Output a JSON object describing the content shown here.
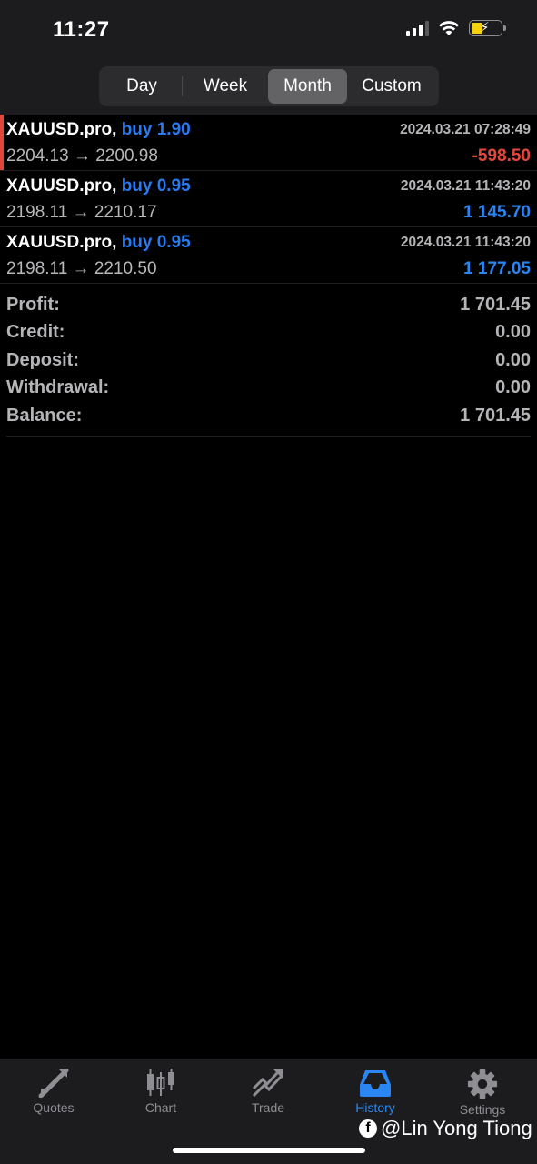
{
  "status_bar": {
    "time": "11:27"
  },
  "period_tabs": [
    {
      "label": "Day"
    },
    {
      "label": "Week"
    },
    {
      "label": "Month",
      "active": true
    },
    {
      "label": "Custom"
    }
  ],
  "trades": [
    {
      "symbol": "XAUUSD.pro,",
      "side": "buy 1.90",
      "datetime": "2024.03.21 07:28:49",
      "prices": "2204.13 → 2200.98",
      "profit": "-598.50",
      "result": "loss"
    },
    {
      "symbol": "XAUUSD.pro,",
      "side": "buy 0.95",
      "datetime": "2024.03.21 11:43:20",
      "prices": "2198.11 → 2210.17",
      "profit": "1 145.70",
      "result": "gain"
    },
    {
      "symbol": "XAUUSD.pro,",
      "side": "buy 0.95",
      "datetime": "2024.03.21 11:43:20",
      "prices": "2198.11 → 2210.50",
      "profit": "1 177.05",
      "result": "gain"
    }
  ],
  "summary": {
    "profit_label": "Profit:",
    "profit_value": "1 701.45",
    "credit_label": "Credit:",
    "credit_value": "0.00",
    "deposit_label": "Deposit:",
    "deposit_value": "0.00",
    "withdrawal_label": "Withdrawal:",
    "withdrawal_value": "0.00",
    "balance_label": "Balance:",
    "balance_value": "1 701.45"
  },
  "tabbar": {
    "items": [
      {
        "label": "Quotes",
        "icon": "quotes-icon"
      },
      {
        "label": "Chart",
        "icon": "chart-icon"
      },
      {
        "label": "Trade",
        "icon": "trade-icon"
      },
      {
        "label": "History",
        "icon": "history-icon",
        "active": true
      },
      {
        "label": "Settings",
        "icon": "settings-icon"
      }
    ]
  },
  "watermark": {
    "text": "@Lin Yong Tiong"
  },
  "colors": {
    "loss": "#e4473c",
    "gain": "#2a86f2",
    "accent": "#2a86f2",
    "background": "#000000"
  }
}
